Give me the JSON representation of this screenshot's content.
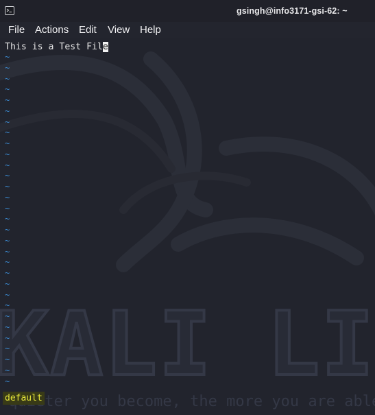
{
  "window": {
    "title": "gsingh@info3171-gsi-62: ~",
    "icon": "terminal-icon"
  },
  "menu": {
    "items": [
      "File",
      "Actions",
      "Edit",
      "View",
      "Help"
    ]
  },
  "editor": {
    "line_before_cursor": "This is a Test Fil",
    "cursor_char": "e",
    "tilde": "~",
    "empty_line_count": 31,
    "tilde_color": "#3c8dd6"
  },
  "background": {
    "watermark": "KALI LINUX",
    "tagline": "\"the quieter you become, the more you are able to hear\""
  },
  "status": {
    "mode_text": "default",
    "mode_bg": "#383a17",
    "mode_fg": "#e6e63a"
  }
}
